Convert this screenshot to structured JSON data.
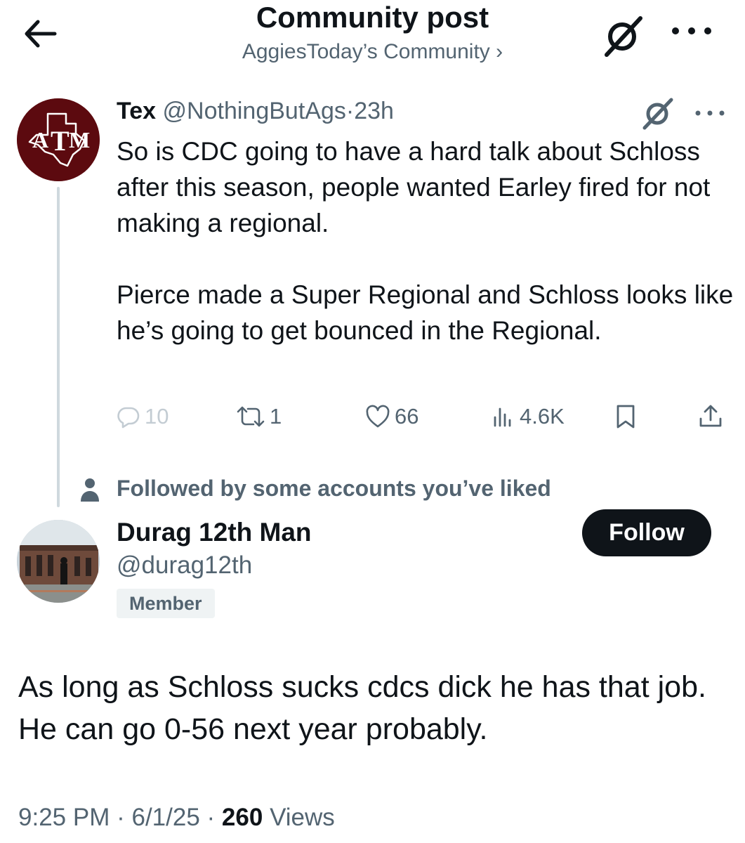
{
  "header": {
    "title": "Community post",
    "subtitle": "AggiesToday’s Community ›"
  },
  "tweet": {
    "name": "Tex",
    "handle": "@NothingButAgs",
    "sep": "·",
    "time": "23h",
    "paragraph1": "So is CDC going to have a hard talk about Schloss after this season, people wanted Earley fired for not making a regional.",
    "paragraph2": "Pierce made a Super Regional and Schloss looks like he’s going to get bounced in the Regional.",
    "actions": {
      "replies": "10",
      "reposts": "1",
      "likes": "66",
      "views": "4.6K"
    }
  },
  "social_context": "Followed by some accounts you’ve liked",
  "reply": {
    "name": "Durag 12th Man",
    "handle": "@durag12th",
    "badge": "Member",
    "follow_label": "Follow",
    "text": "As long as Schloss sucks cdcs dick he has that job. He can go 0-56 next year probably.",
    "time": "9:25 PM",
    "sep1": "·",
    "date": "6/1/25",
    "sep2": "·",
    "views_count": "260",
    "views_label": "Views"
  },
  "colors": {
    "text": "#0f1419",
    "secondary": "#536471",
    "aggie_maroon": "#5c0a0f",
    "button_bg": "#0f1419"
  },
  "icons": [
    "back-arrow-icon",
    "grok-icon",
    "more-icon",
    "reply-icon",
    "repost-icon",
    "like-icon",
    "views-icon",
    "bookmark-icon",
    "share-icon",
    "person-icon"
  ]
}
